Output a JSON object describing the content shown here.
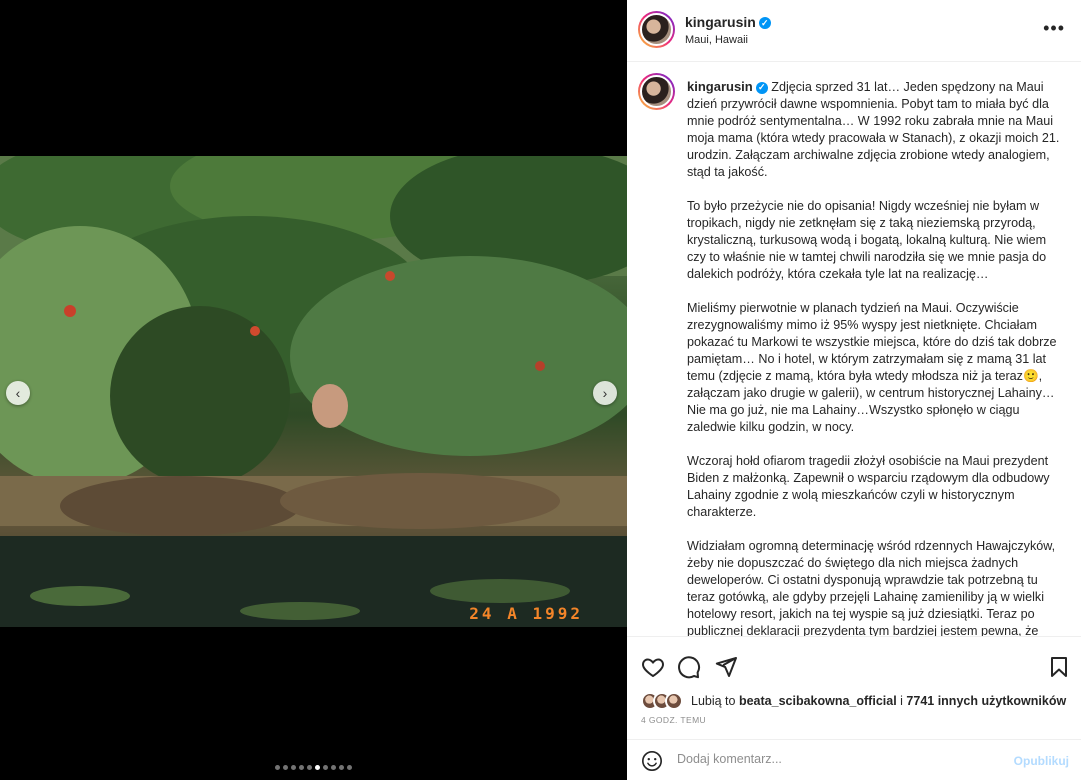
{
  "media": {
    "date_stamp": "24  A 1992",
    "carousel_count": 10,
    "active_index": 5
  },
  "post": {
    "username": "kingarusin",
    "location": "Maui, Hawaii",
    "caption": [
      "Zdjęcia sprzed 31 lat… Jeden spędzony na Maui dzień przywrócił dawne wspomnienia. Pobyt tam to miała być dla mnie podróż sentymentalna… W 1992 roku zabrała mnie na Maui moja mama (która wtedy pracowała w Stanach), z okazji moich 21. urodzin. Załączam archiwalne zdjęcia zrobione wtedy analogiem, stąd ta jakość.",
      "To było przeżycie nie do opisania! Nigdy wcześniej nie byłam w tropikach, nigdy nie zetknęłam się z taką nieziemską przyrodą, krystaliczną, turkusową wodą i bogatą, lokalną kulturą. Nie wiem czy to właśnie nie w tamtej chwili narodziła się we mnie pasja do dalekich podróży, która czekała tyle lat na realizację…",
      "Mieliśmy pierwotnie w planach tydzień na Maui. Oczywiście zrezygnowaliśmy mimo iż 95% wyspy jest nietknięte. Chciałam pokazać tu Markowi te wszystkie miejsca, które do dziś tak dobrze pamiętam… No i hotel, w którym zatrzymałam się z mamą 31 lat temu (zdjęcie z mamą, która była wtedy młodsza niż ja teraz🙂, załączam jako drugie w galerii), w centrum historycznej Lahainy… Nie ma go już, nie ma Lahainy…Wszystko spłonęło w ciągu zaledwie kilku godzin, w nocy.",
      "Wczoraj hołd ofiarom tragedii złożył osobiście na Maui prezydent Biden z małżonką. Zapewnił o wsparciu rządowym dla odbudowy Lahainy zgodnie z wolą mieszkańców czyli w historycznym charakterze.",
      "Widziałam ogromną determinację wśród rdzennych Hawajczyków, żeby nie dopuszczać do świętego dla nich miejsca żadnych deweloperów. Ci ostatni dysponują wprawdzie tak potrzebną tu teraz gotówką, ale gdyby przejęli Lahainę zamieniliby ją w wielki hotelowy resort, jakich na tej wyspie są już dziesiątki. Teraz po publicznej deklaracji prezydenta tym bardziej jestem pewna, że Hawajczycy odbudują miasto na własnych zasadach, że stanie się"
    ]
  },
  "likes": {
    "prefix": "Lubią to",
    "user": "beata_scibakowna_official",
    "middle": "i",
    "others": "7741 innych użytkowników"
  },
  "time_ago": "4 GODZ. TEMU",
  "comment": {
    "placeholder": "Dodaj komentarz...",
    "post_label": "Opublikuj"
  },
  "icons": {
    "like": "heart-icon",
    "comment": "comment-icon",
    "share": "share-icon",
    "save": "bookmark-icon",
    "emoji": "emoji-icon",
    "more": "more-icon"
  },
  "colors": {
    "verified": "#0095f6",
    "post_button_disabled": "#b3dbff",
    "stamp": "#ff8a2a"
  }
}
